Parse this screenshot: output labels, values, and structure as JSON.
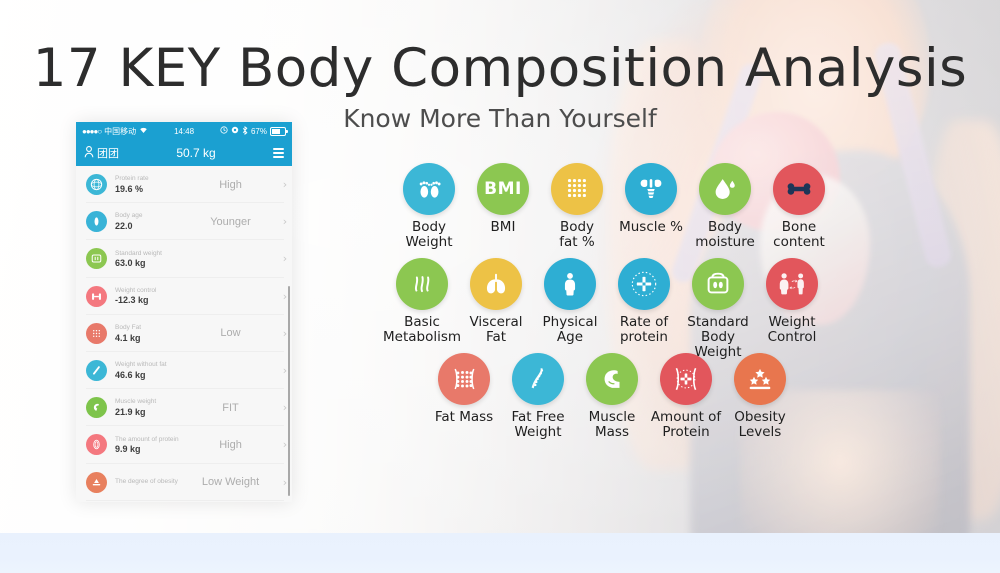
{
  "header": {
    "title": "17 KEY Body Composition Analysis",
    "subtitle": "Know More Than Yourself"
  },
  "colors": {
    "brand_blue": "#1ba0d1",
    "cyan": "#3cb7d6",
    "green": "#8cc751",
    "yellow": "#edc246",
    "red": "#e2565c",
    "salmon": "#e8796a",
    "orange": "#e87a4e",
    "pink": "#f4787f",
    "title_text": "#2d2d2d",
    "bottom_band": "#eaf2fe"
  },
  "phone": {
    "status_bar": {
      "signal_dots": "●●●●○",
      "carrier": "中国移动",
      "wifi_icon": "wifi-icon",
      "time": "14:48",
      "alarm_icon": "alarm-icon",
      "rotation_lock_icon": "rotation-lock-icon",
      "bluetooth_icon": "bluetooth-icon",
      "battery_percent": "67%",
      "battery_icon": "battery-icon"
    },
    "nav_bar": {
      "user_icon": "person-icon",
      "user_name": "团团",
      "weight": "50.7 kg",
      "menu_icon": "list-menu-icon"
    },
    "rows": [
      {
        "icon": "protein-rate-icon",
        "color": "#3cb7d6",
        "label": "Protein rate",
        "value": "19.6 %",
        "state": "High",
        "chevron": "›"
      },
      {
        "icon": "body-age-icon",
        "color": "#39b3d7",
        "label": "Body age",
        "value": "22.0",
        "state": "Younger",
        "chevron": "›"
      },
      {
        "icon": "standard-weight-icon",
        "color": "#8cc751",
        "label": "Standard weight",
        "value": "63.0 kg",
        "state": "",
        "chevron": "›"
      },
      {
        "icon": "weight-control-icon",
        "color": "#f4787f",
        "label": "Weight control",
        "value": "-12.3 kg",
        "state": "",
        "chevron": "›"
      },
      {
        "icon": "body-fat-icon",
        "color": "#e8796a",
        "label": "Body Fat",
        "value": "4.1 kg",
        "state": "Low",
        "chevron": "›"
      },
      {
        "icon": "weight-without-fat-icon",
        "color": "#3cb7d6",
        "label": "Weight without fat",
        "value": "46.6 kg",
        "state": "",
        "chevron": "›"
      },
      {
        "icon": "muscle-weight-icon",
        "color": "#7ec44b",
        "label": "Muscle weight",
        "value": "21.9 kg",
        "state": "FIT",
        "chevron": "›"
      },
      {
        "icon": "amount-of-protein-icon",
        "color": "#f4787f",
        "label": "The amount of protein",
        "value": "9.9 kg",
        "state": "High",
        "chevron": "›"
      },
      {
        "icon": "degree-of-obesity-icon",
        "color": "#e8805e",
        "label": "The degree of obesity",
        "value": "",
        "state": "Low Weight",
        "chevron": "›"
      }
    ]
  },
  "features": {
    "row1": [
      {
        "icon": "footprints-icon",
        "color": "#3cb7d6",
        "label": "Body\nWeight"
      },
      {
        "icon": "bmi-text-icon",
        "color": "#8cc751",
        "label": "BMI",
        "glyph_text": "BMI"
      },
      {
        "icon": "fat-dots-icon",
        "color": "#edc246",
        "label": "Body\nfat %"
      },
      {
        "icon": "muscle-back-icon",
        "color": "#2eaed3",
        "label": "Muscle %"
      },
      {
        "icon": "water-drop-icon",
        "color": "#8cc751",
        "label": "Body\nmoisture"
      },
      {
        "icon": "bone-icon",
        "color": "#e2565c",
        "label": "Bone\ncontent"
      }
    ],
    "row2": [
      {
        "icon": "flame-waves-icon",
        "color": "#8cc751",
        "label": "Basic\nMetabolism"
      },
      {
        "icon": "lungs-icon",
        "color": "#edc246",
        "label": "Visceral\nFat"
      },
      {
        "icon": "human-body-icon",
        "color": "#2eaed3",
        "label": "Physical\nAge"
      },
      {
        "icon": "protein-molecule-icon",
        "color": "#2eaed3",
        "label": "Rate of\nprotein"
      },
      {
        "icon": "scale-body-icon",
        "color": "#8cc751",
        "label": "Standard\nBody Weight"
      },
      {
        "icon": "two-people-icon",
        "color": "#e2565c",
        "label": "Weight\nControl"
      }
    ],
    "row3": [
      {
        "icon": "fat-cells-icon",
        "color": "#e8796a",
        "label": "Fat Mass"
      },
      {
        "icon": "spine-icon",
        "color": "#3cb7d6",
        "label": "Fat Free\nWeight"
      },
      {
        "icon": "flexed-arm-icon",
        "color": "#8cc751",
        "label": "Muscle\nMass"
      },
      {
        "icon": "protein-cell-icon",
        "color": "#e2565c",
        "label": "Amount of\nProtein"
      },
      {
        "icon": "stars-icon",
        "color": "#e8764e",
        "label": "Obesity\nLevels"
      }
    ]
  }
}
